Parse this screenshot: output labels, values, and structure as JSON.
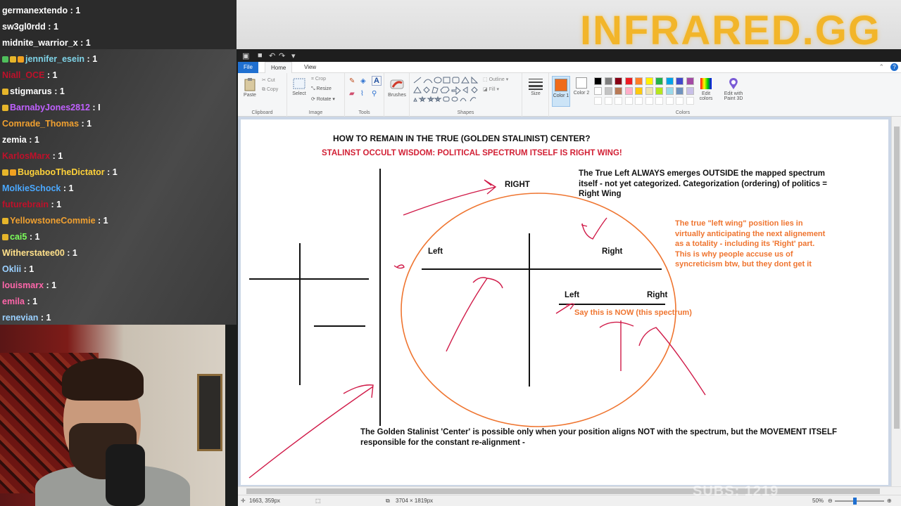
{
  "brand": {
    "name": "INFRARED.GG",
    "subs": "SUBS: 1219"
  },
  "chat": [
    {
      "user": "germanextendo",
      "count": "1",
      "color": "#ffffff",
      "badges": []
    },
    {
      "user": "sw3gl0rdd",
      "count": "1",
      "color": "#ffffff",
      "badges": []
    },
    {
      "user": "midnite_warrior_x",
      "count": "1",
      "color": "#ffffff",
      "badges": []
    },
    {
      "user": "jennifer_esein",
      "count": "1",
      "color": "#7fd4e8",
      "badges": [
        "#4fbf5c",
        "#e6b52a",
        "#f0a020"
      ]
    },
    {
      "user": "Niall_OCE",
      "count": "1",
      "color": "#c0102a",
      "badges": []
    },
    {
      "user": "stigmarus",
      "count": "1",
      "color": "#ffffff",
      "badges": [
        "#e6b52a"
      ]
    },
    {
      "user": "BarnabyJones2812",
      "count": "I",
      "color": "#c060ff",
      "badges": [
        "#e6b52a"
      ]
    },
    {
      "user": "Comrade_Thomas",
      "count": "1",
      "color": "#f0a030",
      "badges": []
    },
    {
      "user": "zemia",
      "count": "1",
      "color": "#ffffff",
      "badges": []
    },
    {
      "user": "KarlosMarx",
      "count": "1",
      "color": "#c0102a",
      "badges": []
    },
    {
      "user": "BugabooTheDictator",
      "count": "1",
      "color": "#ffd23a",
      "badges": [
        "#e6b52a",
        "#f0a020"
      ]
    },
    {
      "user": "MolkieSchock",
      "count": "1",
      "color": "#4aa8ff",
      "badges": []
    },
    {
      "user": "futurebrain",
      "count": "1",
      "color": "#c0102a",
      "badges": []
    },
    {
      "user": "YellowstoneCommie",
      "count": "1",
      "color": "#f0a030",
      "badges": [
        "#e6b52a"
      ]
    },
    {
      "user": "cai5",
      "count": "1",
      "color": "#7cff5a",
      "badges": [
        "#e6b52a"
      ]
    },
    {
      "user": "Witherstatee00",
      "count": "1",
      "color": "#ffe08a",
      "badges": []
    },
    {
      "user": "Oklii",
      "count": "1",
      "color": "#9ad0ff",
      "badges": []
    },
    {
      "user": "louismarx",
      "count": "1",
      "color": "#ff66aa",
      "badges": []
    },
    {
      "user": "emila",
      "count": "1",
      "color": "#ff66aa",
      "badges": []
    },
    {
      "user": "renevian",
      "count": "1",
      "color": "#9ad0ff",
      "badges": []
    }
  ],
  "paint": {
    "tabs": {
      "file": "File",
      "home": "Home",
      "view": "View"
    },
    "clipboard": {
      "paste": "Paste",
      "cut": "Cut",
      "copy": "Copy",
      "label": "Clipboard"
    },
    "image": {
      "select": "Select",
      "crop": "Crop",
      "resize": "Resize",
      "rotate": "Rotate",
      "label": "Image"
    },
    "tools": {
      "label": "Tools"
    },
    "brushes": {
      "label": "Brushes"
    },
    "shapes": {
      "outline": "Outline",
      "fill": "Fill",
      "label": "Shapes"
    },
    "size": {
      "label": "Size"
    },
    "colors": {
      "color1": "Color 1",
      "color2": "Color 2",
      "edit": "Edit colors",
      "paint3d": "Edit with Paint 3D",
      "label": "Colors",
      "active": "#ef6b1b",
      "palette": [
        "#000000",
        "#7f7f7f",
        "#880015",
        "#ed1c24",
        "#ff7f27",
        "#fff200",
        "#22b14c",
        "#00a2e8",
        "#3f48cc",
        "#a349a4",
        "#ffffff",
        "#c3c3c3",
        "#b97a57",
        "#ffaec9",
        "#ffc90e",
        "#efe4b0",
        "#b5e61d",
        "#99d9ea",
        "#7092be",
        "#c8bfe7"
      ]
    },
    "status": {
      "cursor": "1663, 359px",
      "dimensions": "3704 × 1819px",
      "zoom": "50%"
    }
  },
  "canvas": {
    "heading": "HOW TO REMAIN IN THE TRUE (GOLDEN STALINIST) CENTER?",
    "subheading": "STALINST OCCULT WISDOM: POLITICAL SPECTRUM ITSELF IS RIGHT WING!",
    "right_label": "RIGHT",
    "true_left_note": "The True Left ALWAYS emerges OUTSIDE the mapped spectrum itself - not yet categorized. Categorization (ordering) of politics = Right Wing",
    "orange_note": "The true \"left wing\" position lies in virtually anticipating the next alignement as a totality - including its 'Right' part. This is why people accuse us of syncreticism btw, but they dont get it",
    "left_big": "Left",
    "right_big": "Right",
    "left_small": "Left",
    "right_small": "Right",
    "now_note": "Say this is NOW (this spectrum)",
    "bottom_note": "The Golden Stalinist 'Center' is possible only when your position aligns NOT with the spectrum, but the MOVEMENT ITSELF responsible for the constant re-alignment -"
  }
}
